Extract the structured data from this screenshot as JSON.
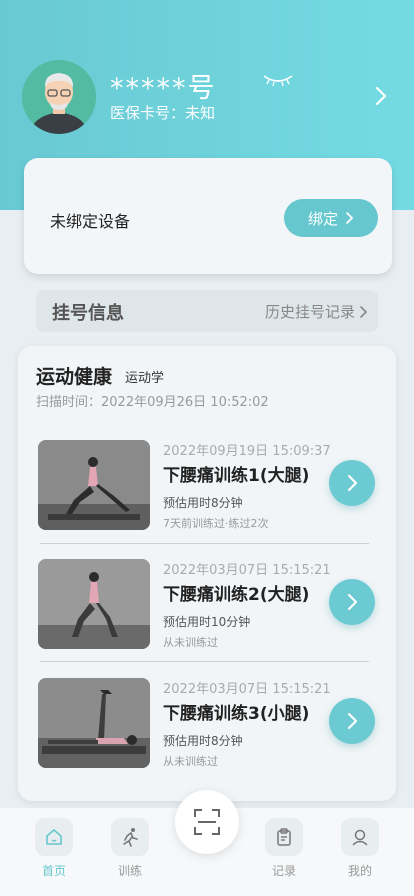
{
  "profile": {
    "name": "*****号",
    "card_label": "医保卡号：未知"
  },
  "device": {
    "status_text": "未绑定设备",
    "bind_label": "绑定"
  },
  "registration": {
    "title": "挂号信息",
    "history_link": "历史挂号记录"
  },
  "exercise": {
    "title": "运动健康",
    "subtitle": "运动学",
    "scan_time": "扫描时间：2022年09月26日 10:52:02",
    "items": [
      {
        "time": "2022年09月19日 15:09:37",
        "name": "下腰痛训练1(大腿)",
        "estimate": "预估用时8分钟",
        "history": "7天前训练过·练过2次"
      },
      {
        "time": "2022年03月07日 15:15:21",
        "name": "下腰痛训练2(大腿)",
        "estimate": "预估用时10分钟",
        "history": "从未训练过"
      },
      {
        "time": "2022年03月07日 15:15:21",
        "name": "下腰痛训练3(小腿)",
        "estimate": "预估用时8分钟",
        "history": "从未训练过"
      }
    ]
  },
  "tabs": [
    {
      "label": "首页",
      "icon": "home-icon",
      "active": true
    },
    {
      "label": "训练",
      "icon": "running-icon",
      "active": false
    },
    {
      "label": "记录",
      "icon": "clipboard-icon",
      "active": false
    },
    {
      "label": "我的",
      "icon": "user-icon",
      "active": false
    }
  ],
  "colors": {
    "accent": "#67c7cf",
    "hero_start": "#69c9d3",
    "hero_end": "#74dbe3"
  }
}
